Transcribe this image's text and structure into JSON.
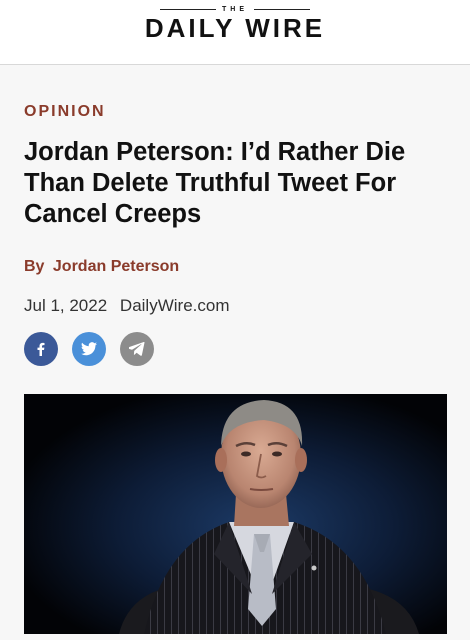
{
  "header": {
    "logo_the": "THE",
    "logo_main": "DAILY WIRE"
  },
  "article": {
    "section": "OPINION",
    "headline": "Jordan Peterson: I’d Rather Die Than Delete Truthful Tweet For Cancel Creeps",
    "byline_prefix": "By",
    "author": "Jordan Peterson",
    "date": "Jul 1, 2022",
    "source": "DailyWire.com"
  },
  "share": {
    "buttons": [
      {
        "icon": "facebook-icon",
        "color": "#3b5998"
      },
      {
        "icon": "twitter-icon",
        "color": "#4a90d9"
      },
      {
        "icon": "telegram-icon",
        "color": "#8c8c8c"
      }
    ]
  },
  "colors": {
    "accent": "#8a3b2b",
    "headline": "#111111",
    "background": "#f7f7f7"
  },
  "hero_image": {
    "description_icon": "portrait-photo"
  }
}
